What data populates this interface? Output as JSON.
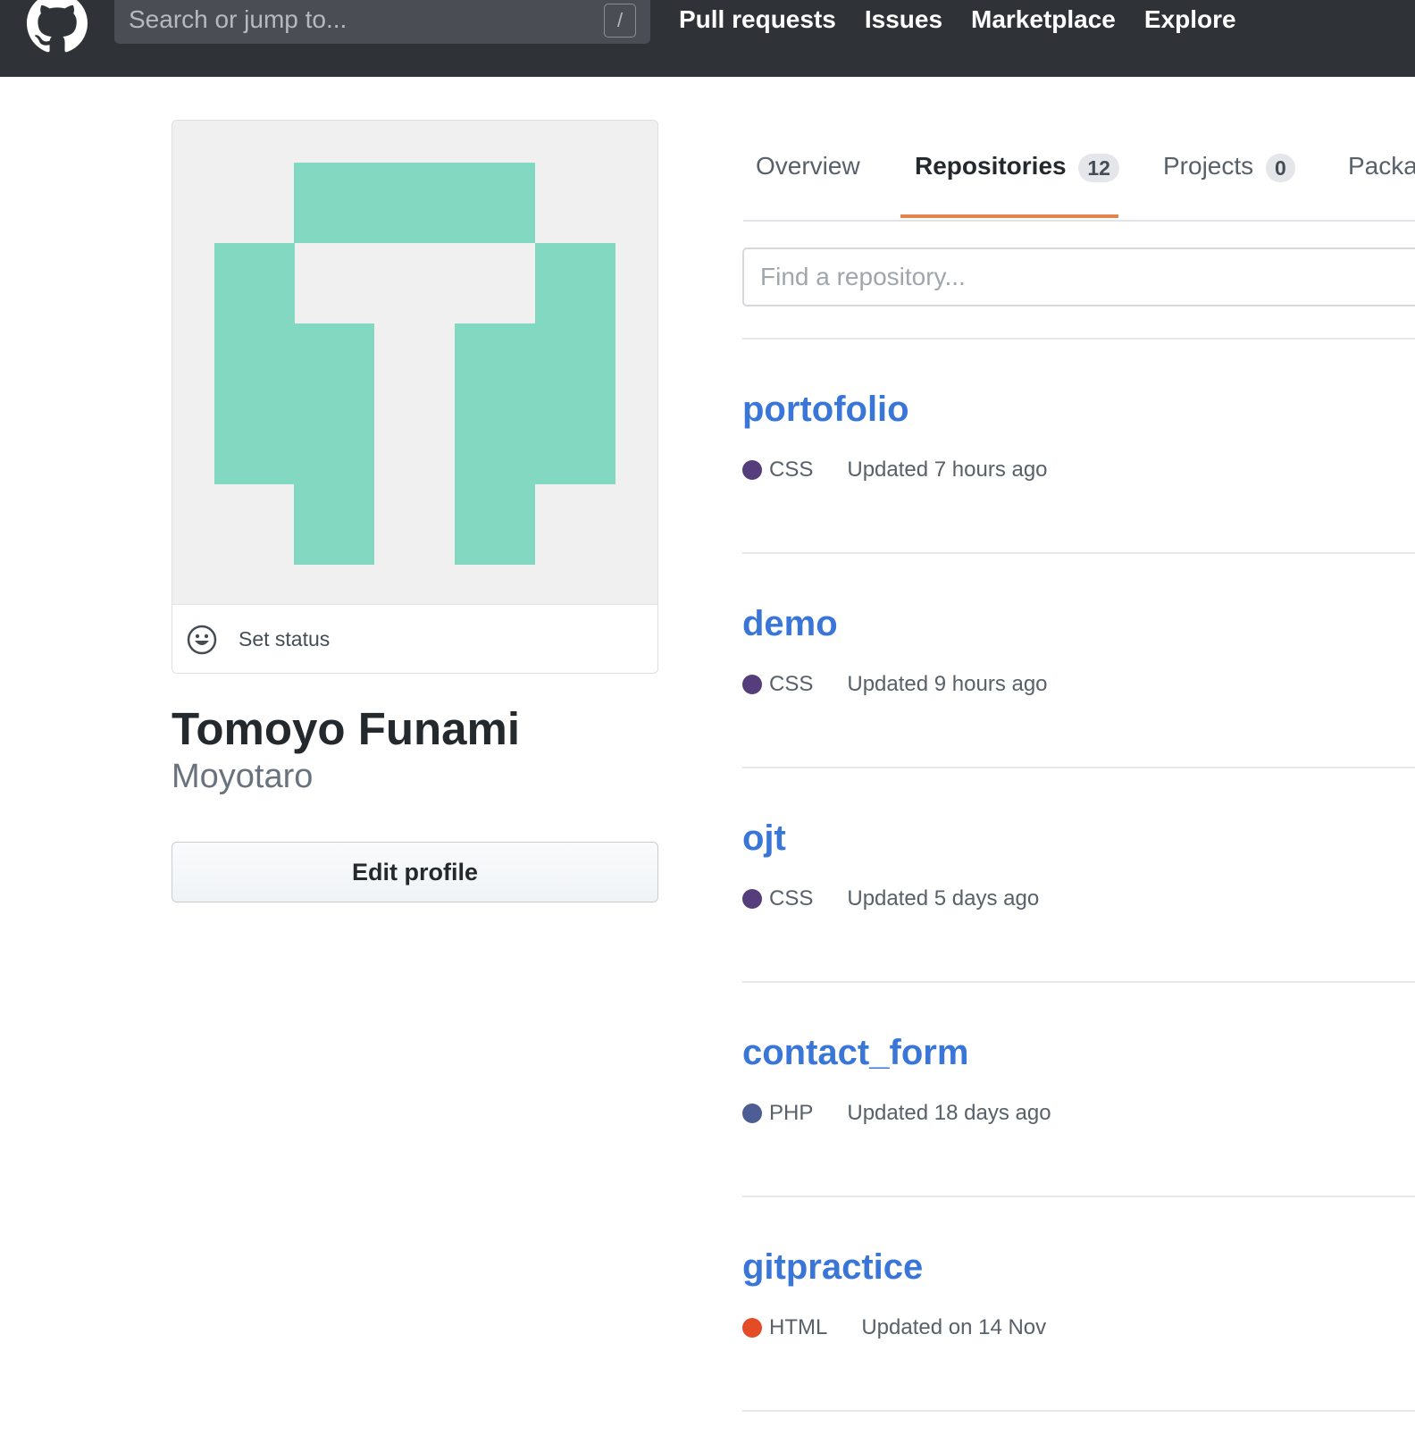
{
  "header": {
    "search_placeholder": "Search or jump to...",
    "search_shortcut": "/",
    "nav": [
      "Pull requests",
      "Issues",
      "Marketplace",
      "Explore"
    ]
  },
  "profile": {
    "status_label": "Set status",
    "full_name": "Tomoyo Funami",
    "username": "Moyotaro",
    "edit_button": "Edit profile",
    "avatar_color": "#83d8c2"
  },
  "tabs": {
    "overview": "Overview",
    "repositories": "Repositories",
    "repositories_count": "12",
    "projects": "Projects",
    "projects_count": "0",
    "packages": "Packa"
  },
  "filter": {
    "placeholder": "Find a repository..."
  },
  "repositories": [
    {
      "name": "portofolio",
      "language": "CSS",
      "language_color": "#563d7c",
      "updated": "Updated 7 hours ago"
    },
    {
      "name": "demo",
      "language": "CSS",
      "language_color": "#563d7c",
      "updated": "Updated 9 hours ago"
    },
    {
      "name": "ojt",
      "language": "CSS",
      "language_color": "#563d7c",
      "updated": "Updated 5 days ago"
    },
    {
      "name": "contact_form",
      "language": "PHP",
      "language_color": "#4F5D95",
      "updated": "Updated 18 days ago"
    },
    {
      "name": "gitpractice",
      "language": "HTML",
      "language_color": "#e34c26",
      "updated": "Updated on 14 Nov"
    }
  ]
}
